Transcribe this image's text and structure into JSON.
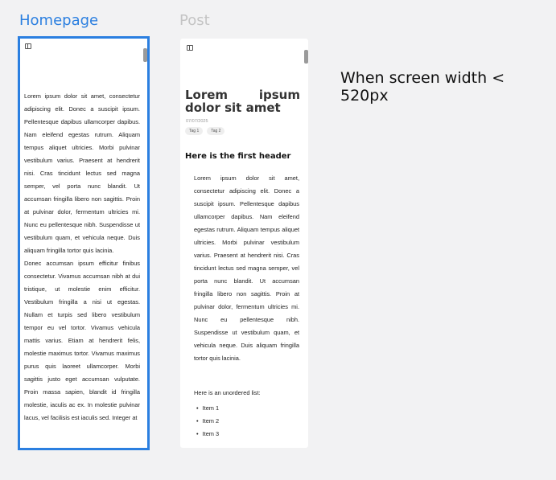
{
  "frames": {
    "home_title": "Homepage",
    "post_title": "Post"
  },
  "home": {
    "paragraphs": [
      "Lorem ipsum dolor sit amet, consectetur adipiscing elit. Donec a suscipit ipsum. Pellentesque dapibus ullamcorper dapibus. Nam eleifend egestas rutrum. Aliquam tempus aliquet ultricies. Morbi pulvinar vestibulum varius. Praesent at hendrerit nisi. Cras tincidunt lectus sed magna semper, vel porta nunc blandit. Ut accumsan fringilla libero non sagittis. Proin at pulvinar dolor, fermentum ultricies mi. Nunc eu pellentesque nibh. Suspendisse ut vestibulum quam, et vehicula neque. Duis aliquam fringilla tortor quis lacinia.",
      "Donec accumsan ipsum efficitur finibus consectetur. Vivamus accumsan nibh at dui tristique, ut molestie enim efficitur. Vestibulum fringilla a nisi ut egestas. Nullam et turpis sed libero vestibulum tempor eu vel tortor. Vivamus vehicula mattis varius. Etiam at hendrerit felis, molestie maximus tortor. Vivamus maximus purus quis laoreet ullamcorper. Morbi sagittis justo eget accumsan vulputate. Proin massa sapien, blandit id fringilla molestie, iaculis ac ex. In molestie pulvinar lacus, vel facilisis est iaculis sed. Integer at"
    ]
  },
  "post": {
    "title": "Lorem ipsum dolor sit amet",
    "date": "07/07/2025",
    "tags": [
      "Tag 1",
      "Tag 2"
    ],
    "header": "Here is the first header",
    "body": "Lorem ipsum dolor sit amet, consectetur adipiscing elit. Donec a suscipit ipsum. Pellentesque dapibus ullamcorper dapibus. Nam eleifend egestas rutrum. Aliquam tempus aliquet ultricies. Morbi pulvinar vestibulum varius. Praesent at hendrerit nisi. Cras tincidunt lectus sed magna semper, vel porta nunc blandit. Ut accumsan fringilla libero non sagittis. Proin at pulvinar dolor, fermentum ultricies mi. Nunc eu pellentesque nibh. Suspendisse ut vestibulum quam, et vehicula neque. Duis aliquam fringilla tortor quis lacinia.",
    "list_heading": "Here is an unordered list:",
    "list_items": [
      "Item 1",
      "Item 2",
      "Item 3"
    ]
  },
  "annotation": "When screen width < 520px",
  "colors": {
    "selected_frame": "#2b7fe0",
    "background": "#f2f2f3"
  },
  "icons": [
    "sidebar-toggle-icon"
  ]
}
